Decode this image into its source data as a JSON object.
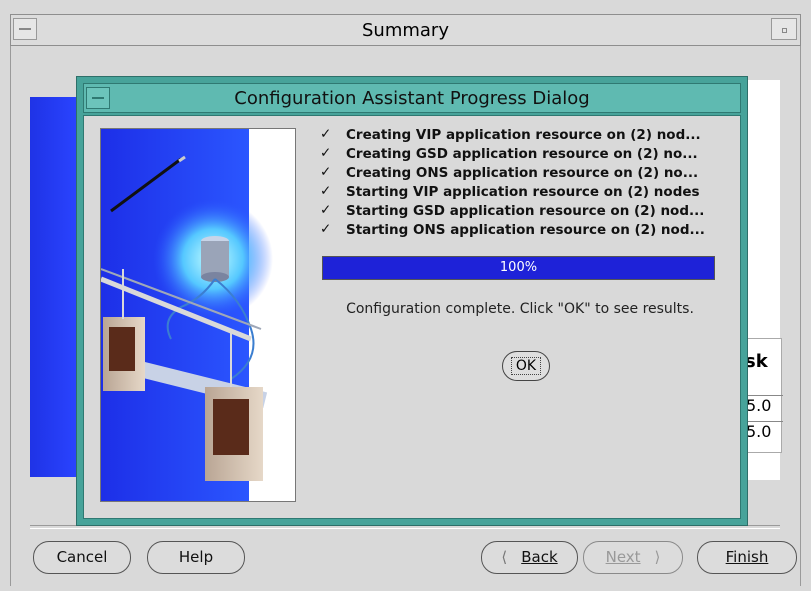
{
  "window": {
    "title": "Summary"
  },
  "dialog": {
    "title": "Configuration Assistant Progress Dialog",
    "items": [
      {
        "text": "Creating VIP application resource on (2) nod..."
      },
      {
        "text": "Creating GSD application resource on (2) no..."
      },
      {
        "text": "Creating ONS application resource on (2) no..."
      },
      {
        "text": "Starting VIP application resource on (2) nodes"
      },
      {
        "text": "Starting GSD application resource on (2) nod..."
      },
      {
        "text": "Starting ONS application resource on (2) nod..."
      }
    ],
    "check_glyph": "✓",
    "progress_value": 100,
    "progress_label": "100%",
    "message": "Configuration complete. Click \"OK\" to see results.",
    "ok_label": "OK"
  },
  "background": {
    "table_header": "sk",
    "rows": [
      "5.0",
      "5.0"
    ]
  },
  "footer": {
    "cancel": "Cancel",
    "help": "Help",
    "back": "Back",
    "next": "Next",
    "finish": "Finish"
  },
  "colors": {
    "dialog_frame": "#47a39a",
    "progress_bar": "#1e22d8",
    "illustration_blue": "#2438f0"
  }
}
